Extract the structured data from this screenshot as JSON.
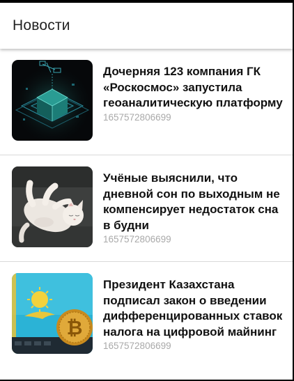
{
  "app_bar": {
    "title": "Новости"
  },
  "news": [
    {
      "title": "Дочерняя 123 компания ГК «Роскосмос» запустила геоаналитическую платформу",
      "timestamp": "1657572806699",
      "image_icon": "satellite-cube-illustration"
    },
    {
      "title": "Учёные выяснили, что дневной сон по выходным не компенсирует недостаток сна в будни",
      "timestamp": "1657572806699",
      "image_icon": "sleeping-cat-photo"
    },
    {
      "title": "Президент Казахстана подписал закон о введении дифференцированных ставок налога на цифровой майнинг",
      "timestamp": "1657572806699",
      "image_icon": "kazakhstan-flag-bitcoin-photo"
    }
  ],
  "colors": {
    "title_text": "#222222",
    "headline_text": "#111111",
    "timestamp_text": "#a9a9a9",
    "divider": "#d9d9d9"
  }
}
